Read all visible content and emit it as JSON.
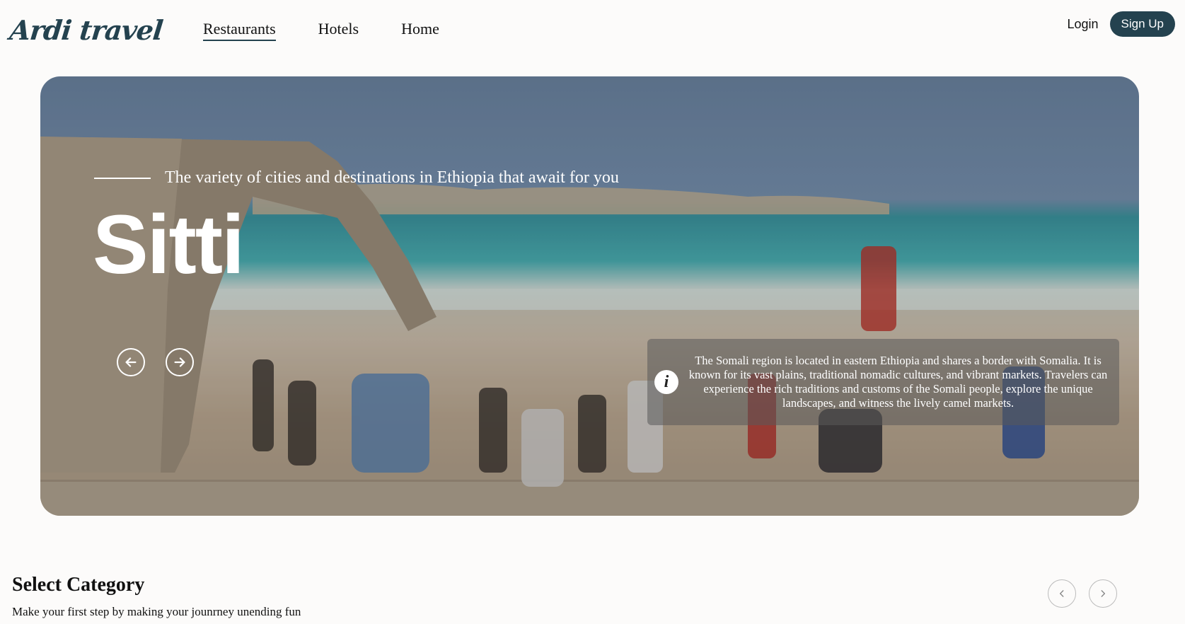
{
  "header": {
    "logo": "Ardi travel",
    "nav": [
      "Restaurants",
      "Hotels",
      "Home"
    ],
    "active_nav": "Restaurants",
    "login": "Login",
    "signup": "Sign Up"
  },
  "hero": {
    "tagline": "The variety of cities and destinations in Ethiopia that await for you",
    "city": "Sitti",
    "info_text": "The Somali region is located in eastern Ethiopia and shares a border with Somalia. It is known for its vast plains, traditional nomadic cultures, and vibrant markets. Travelers can experience the rich traditions and customs of the Somali people, explore the unique landscapes, and witness the lively camel markets.",
    "prev_icon": "arrow-left-circle-icon",
    "next_icon": "arrow-right-circle-icon",
    "info_icon": "info-icon"
  },
  "category": {
    "title": "Select Category",
    "subtitle": "Make your first step by making your jounrney unending fun",
    "prev_icon": "chevron-left-icon",
    "next_icon": "chevron-right-icon"
  },
  "colors": {
    "brand": "#24424f",
    "background": "#fcfbfa"
  }
}
